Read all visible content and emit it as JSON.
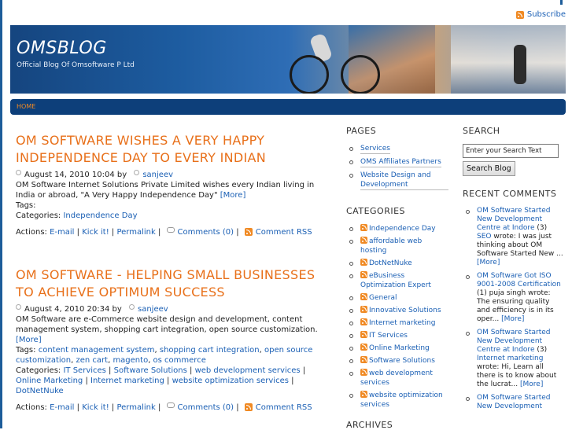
{
  "subscribe": "Subscribe",
  "site": {
    "title": "OMSBLOG",
    "tagline": "Official Blog Of Omsoftware P Ltd"
  },
  "nav": {
    "home": "HOME"
  },
  "posts": [
    {
      "title": "OM SOFTWARE WISHES A VERY HAPPY INDEPENDENCE DAY TO EVERY INDIAN",
      "date": "August 14, 2010 10:04 by",
      "author": "sanjeev",
      "body": "OM Software Internet Solutions Private Limited wishes every Indian living in India or abroad, \"A Very Happy Independence Day\"",
      "more": "[More]",
      "tags_label": "Tags:",
      "tags": [],
      "categories_label": "Categories:",
      "categories": [
        "Independence Day"
      ],
      "actions_label": "Actions:",
      "email": "E-mail",
      "kick": "Kick it!",
      "permalink": "Permalink",
      "comments": "Comments (0)",
      "rss": "Comment RSS"
    },
    {
      "title": "OM SOFTWARE - HELPING SMALL BUSINESSES TO ACHIEVE OPTIMUM SUCCESS",
      "date": "August 4, 2010 20:34 by",
      "author": "sanjeev",
      "body": "OM Software are e-Commerce website design and development, content management system, shopping cart integration, open source customization.",
      "more": "[More]",
      "tags_label": "Tags:",
      "tags": [
        "content management system",
        "shopping cart integration",
        "open source customization",
        "zen cart",
        "magento",
        "os commerce"
      ],
      "categories_label": "Categories:",
      "categories": [
        "IT Services",
        "Software Solutions",
        "web development services",
        "Online Marketing",
        "Internet marketing",
        "website optimization services",
        "DotNetNuke"
      ],
      "actions_label": "Actions:",
      "email": "E-mail",
      "kick": "Kick it!",
      "permalink": "Permalink",
      "comments": "Comments (0)",
      "rss": "Comment RSS"
    }
  ],
  "pages": {
    "title": "PAGES",
    "items": [
      "Services",
      "OMS Affiliates Partners",
      "Website Design and Development"
    ]
  },
  "categories": {
    "title": "CATEGORIES",
    "items": [
      "Independence Day",
      "affordable web hosting",
      "DotNetNuke",
      "eBusiness Optimization Expert",
      "General",
      "Innovative Solutions",
      "Internet marketing",
      "IT Services",
      "Online Marketing",
      "Software Solutions",
      "web development services",
      "website optimization services"
    ]
  },
  "archives": {
    "title": "ARCHIVES"
  },
  "search": {
    "title": "SEARCH",
    "value": "Enter your Search Text",
    "button": "Search Blog"
  },
  "recent": {
    "title": "RECENT COMMENTS",
    "items": [
      {
        "link": "OM Software Started New Development Centre at Indore",
        "count": "(3)",
        "user": "SEO",
        "text": "wrote: I was just thinking about OM Software Started New ...",
        "more": "[More]"
      },
      {
        "link": "OM Software Got ISO 9001-2008 Certification",
        "count": "(1)",
        "user": "",
        "text": "puja singh wrote: The ensuring quality and efficiency is in its oper...",
        "more": "[More]"
      },
      {
        "link": "OM Software Started New Development Centre at Indore",
        "count": "(3)",
        "user": "Internet marketing",
        "text": "wrote: Hi, Learn all there is to know about the lucrat...",
        "more": "[More]"
      },
      {
        "link": "OM Software Started New Development",
        "count": "",
        "user": "",
        "text": "",
        "more": ""
      }
    ]
  }
}
